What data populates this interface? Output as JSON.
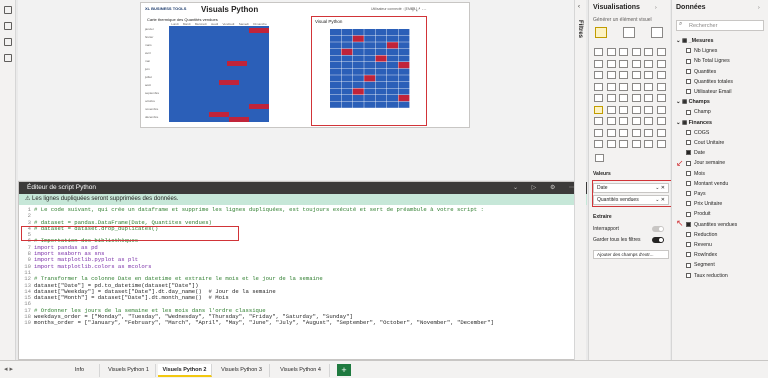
{
  "report": {
    "logo": "XL BUSINESS TOOLS",
    "title": "Visuals Python",
    "user": "Utilisateur connecté : [EMAIL]",
    "heatmap1_title": "Carte thermique des Quantités vendues",
    "days": [
      "Lundi",
      "Mardi",
      "Mercredi",
      "Jeudi",
      "Vendredi",
      "Samedi",
      "Dimanche"
    ],
    "months": [
      "janvier",
      "février",
      "mars",
      "avril",
      "mai",
      "juin",
      "juillet",
      "août",
      "septembre",
      "octobre",
      "novembre",
      "décembre"
    ],
    "heatmap2_title": "Visual Python"
  },
  "editor": {
    "title": "Éditeur de script Python",
    "warning": "Les lignes dupliquées seront supprimées des données.",
    "lines": [
      {
        "n": "1",
        "cls": "cm",
        "t": "# Le code suivant, qui crée un dataframe et supprime les lignes dupliquées, est toujours exécuté et sert de préambule à votre script :"
      },
      {
        "n": "2",
        "cls": "",
        "t": ""
      },
      {
        "n": "3",
        "cls": "cm",
        "t": "# dataset = pandas.DataFrame(Date, Quantites vendues)"
      },
      {
        "n": "4",
        "cls": "cm",
        "t": "# dataset = dataset.drop_duplicates()"
      },
      {
        "n": "5",
        "cls": "",
        "t": ""
      },
      {
        "n": "6",
        "cls": "cm",
        "t": "# Importation des bibliothèques"
      },
      {
        "n": "7",
        "cls": "kw",
        "t": "import pandas as pd"
      },
      {
        "n": "8",
        "cls": "kw",
        "t": "import seaborn as sns"
      },
      {
        "n": "9",
        "cls": "kw",
        "t": "import matplotlib.pyplot as plt"
      },
      {
        "n": "10",
        "cls": "kw",
        "t": "import matplotlib.colors as mcolors"
      },
      {
        "n": "11",
        "cls": "",
        "t": ""
      },
      {
        "n": "12",
        "cls": "cm",
        "t": "# Transformer la colonne Date en datetime et extraire le mois et le jour de la semaine"
      },
      {
        "n": "13",
        "cls": "",
        "t": "dataset[\"Date\"] = pd.to_datetime(dataset[\"Date\"])"
      },
      {
        "n": "14",
        "cls": "",
        "t": "dataset[\"Weekday\"] = dataset[\"Date\"].dt.day_name()  # Jour de la semaine"
      },
      {
        "n": "15",
        "cls": "",
        "t": "dataset[\"Month\"] = dataset[\"Date\"].dt.month_name()  # Mois"
      },
      {
        "n": "16",
        "cls": "",
        "t": ""
      },
      {
        "n": "17",
        "cls": "cm",
        "t": "# Ordonner les jours de la semaine et les mois dans l'ordre classique"
      },
      {
        "n": "18",
        "cls": "",
        "t": "weekdays_order = [\"Monday\", \"Tuesday\", \"Wednesday\", \"Thursday\", \"Friday\", \"Saturday\", \"Sunday\"]"
      },
      {
        "n": "19",
        "cls": "",
        "t": "months_order = [\"January\", \"February\", \"March\", \"April\", \"May\", \"June\", \"July\", \"August\", \"September\", \"October\", \"November\", \"December\"]"
      }
    ]
  },
  "tabs": [
    "Info",
    "Visuels Python 1",
    "Visuels Python 2",
    "Visuels Python 3",
    "Visuels Python 4"
  ],
  "active_tab": "Visuels Python 2",
  "filters_label": "Filtres",
  "viz": {
    "title": "Visualisations",
    "build": "Générer un élément visuel",
    "values_label": "Valeurs",
    "wells": [
      "Date",
      "Quantités vendues"
    ],
    "extra": "Extraire",
    "cross": "Interrapport",
    "keep": "Garder tous les filtres",
    "add": "Ajouter des champs d'extr..."
  },
  "data": {
    "title": "Données",
    "search": "Rechercher",
    "groups": [
      {
        "name": "_Mesures",
        "fields": [
          {
            "n": "Nb Lignes",
            "on": false
          },
          {
            "n": "Nb Total Lignes",
            "on": false
          },
          {
            "n": "Quantites",
            "on": false
          },
          {
            "n": "Quantites totales",
            "on": false
          },
          {
            "n": "Utilisateur Email",
            "on": false
          }
        ]
      },
      {
        "name": "Champs",
        "fields": [
          {
            "n": "Champ",
            "on": false
          }
        ]
      },
      {
        "name": "Finances",
        "fields": [
          {
            "n": "COGS",
            "on": false
          },
          {
            "n": "Cout Unitaire",
            "on": false
          },
          {
            "n": "Date",
            "on": true
          },
          {
            "n": "Jour semaine",
            "on": false
          },
          {
            "n": "Mois",
            "on": false
          },
          {
            "n": "Montant vendu",
            "on": false
          },
          {
            "n": "Pays",
            "on": false
          },
          {
            "n": "Prix Unitaire",
            "on": false
          },
          {
            "n": "Produit",
            "on": false
          },
          {
            "n": "Quantites vendues",
            "on": true
          },
          {
            "n": "Reduction",
            "on": false
          },
          {
            "n": "Revenu",
            "on": false
          },
          {
            "n": "RowIndex",
            "on": false
          },
          {
            "n": "Segment",
            "on": false
          },
          {
            "n": "Taux reduction",
            "on": false
          }
        ]
      }
    ]
  },
  "colors": {
    "accent": "#d13438",
    "heat_low": "#2b5fb8",
    "heat_high": "#c0243a",
    "toggle": "#252423",
    "add_tab": "#1f7a3f"
  }
}
